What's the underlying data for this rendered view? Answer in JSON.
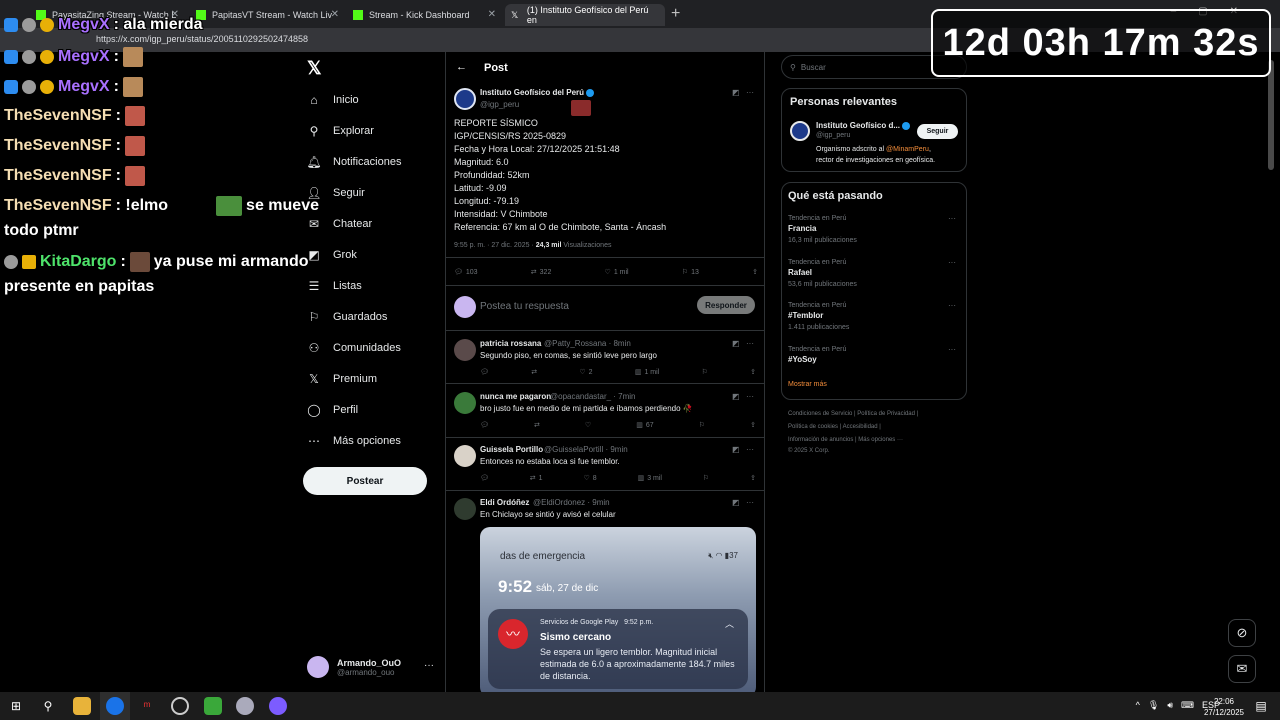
{
  "browser": {
    "tabs": [
      {
        "title": "PayasitaZing Stream - Watch L"
      },
      {
        "title": "PapitasVT Stream - Watch Liv"
      },
      {
        "title": "Stream - Kick Dashboard"
      },
      {
        "title": "(1) Instituto Geofísico del Perú en"
      }
    ],
    "url": "https://x.com/igp_peru/status/2005110292502474858"
  },
  "timer": "12d 03h 17m 32s",
  "chat": [
    {
      "user": "MegvX",
      "text": ": ala mierda"
    },
    {
      "user": "MegvX",
      "text": ":"
    },
    {
      "user": "MegvX",
      "text": ":"
    },
    {
      "user": "TheSevenNSF",
      "text": ":"
    },
    {
      "user": "TheSevenNSF",
      "text": ":"
    },
    {
      "user": "TheSevenNSF",
      "text": ":"
    },
    {
      "user": "TheSevenNSF",
      "text": ": !elmo",
      "after": "se mueve",
      "wrap": "todo ptmr"
    },
    {
      "user": "KitaDargo",
      "text": ":",
      "after": "ya puse mi armando",
      "wrap": "presente en papitas"
    }
  ],
  "sidebar": {
    "items": [
      {
        "label": "Inicio",
        "icon": "home-icon"
      },
      {
        "label": "Explorar",
        "icon": "search-icon"
      },
      {
        "label": "Notificaciones",
        "icon": "bell-icon"
      },
      {
        "label": "Seguir",
        "icon": "follow-icon"
      },
      {
        "label": "Chatear",
        "icon": "mail-icon"
      },
      {
        "label": "Grok",
        "icon": "grok-icon"
      },
      {
        "label": "Listas",
        "icon": "list-icon"
      },
      {
        "label": "Guardados",
        "icon": "bookmark-icon"
      },
      {
        "label": "Comunidades",
        "icon": "communities-icon"
      },
      {
        "label": "Premium",
        "icon": "x-icon"
      },
      {
        "label": "Perfil",
        "icon": "profile-icon"
      },
      {
        "label": "Más opciones",
        "icon": "more-icon"
      }
    ],
    "post_button": "Postear",
    "account": {
      "name": "Armando_OuO",
      "handle": "@armando_ouo"
    }
  },
  "post": {
    "header": "Post",
    "author": "Instituto Geofísico del Perú",
    "handle": "@igp_peru",
    "body": "REPORTE SÍSMICO\nIGP/CENSIS/RS 2025-0829\nFecha y Hora Local: 27/12/2025 21:51:48\nMagnitud: 6.0\nProfundidad: 52km\nLatitud: -9.09\nLongitud: -79.19\nIntensidad: V Chimbote\nReferencia: 67 km al O de Chimbote, Santa - Áncash",
    "time": "9:55 p. m. · 27 dic. 2025 · ",
    "views": "24,3 mil",
    "views_label": " Visualizaciones",
    "stats": {
      "replies": "103",
      "reposts": "322",
      "likes": "1 mil",
      "bookmarks": "13"
    },
    "reply_placeholder": "Postea tu respuesta",
    "reply_button": "Responder"
  },
  "replies": [
    {
      "name": "patricia rossana",
      "handle": "@Patty_Rossana · 8min",
      "text": "Segundo piso, en comas, se sintió leve pero largo",
      "reposts": "",
      "likes": "2",
      "views": "1 mil"
    },
    {
      "name": "nunca me pagaron",
      "handle": "@opacandastar_ · 7min",
      "text": "bro justo fue en medio de mi partida e íbamos perdiendo 🥀",
      "reposts": "",
      "likes": "",
      "views": "67"
    },
    {
      "name": "Guissela Portillo",
      "handle": "@GuisselaPortill · 9min",
      "text": "Entonces no estaba loca si fue temblor.",
      "reposts": "1",
      "likes": "8",
      "views": "3 mil"
    },
    {
      "name": "Eldi Ordóñez",
      "handle": "@EldiOrdonez · 9min",
      "text": "En Chiclayo se sintió y avisó el celular"
    }
  ],
  "phone": {
    "emergency": "das de emergencia",
    "battery": "37",
    "time": "9:52",
    "date": "sáb, 27 de dic",
    "app": "Servicios de Google Play",
    "app_time": "9:52 p.m.",
    "title": "Sismo cercano",
    "body": "Se espera un ligero temblor. Magnitud inicial estimada de 6.0 a aproximadamente 184.7 miles de distancia."
  },
  "right": {
    "search_placeholder": "Buscar",
    "relevant_title": "Personas relevantes",
    "relevant": {
      "name": "Instituto Geofísico d...",
      "handle": "@igp_peru",
      "follow": "Seguir",
      "bio_pre": "Organismo adscrito al ",
      "bio_link": "@MinamPeru",
      "bio_post": ",",
      "bio_line2": "rector de investigaciones en geofísica."
    },
    "trends_title": "Qué está pasando",
    "trends": [
      {
        "context": "Tendencia en Perú",
        "name": "Francia",
        "count": "16,3 mil publicaciones"
      },
      {
        "context": "Tendencia en Perú",
        "name": "Rafael",
        "count": "53,6 mil publicaciones"
      },
      {
        "context": "Tendencia en Perú",
        "name": "#Temblor",
        "count": "1.411 publicaciones"
      },
      {
        "context": "Tendencia en Perú",
        "name": "#YoSoy",
        "count": ""
      }
    ],
    "show_more": "Mostrar más",
    "footer": [
      "Condiciones de Servicio  |  Política de Privacidad  |",
      "Política de cookies  |  Accesibilidad  |",
      "Información de anuncios  |  Más opciones ···",
      "© 2025 X Corp."
    ]
  },
  "taskbar": {
    "lang": "ESP",
    "time": "22:06",
    "date": "27/12/2025"
  }
}
